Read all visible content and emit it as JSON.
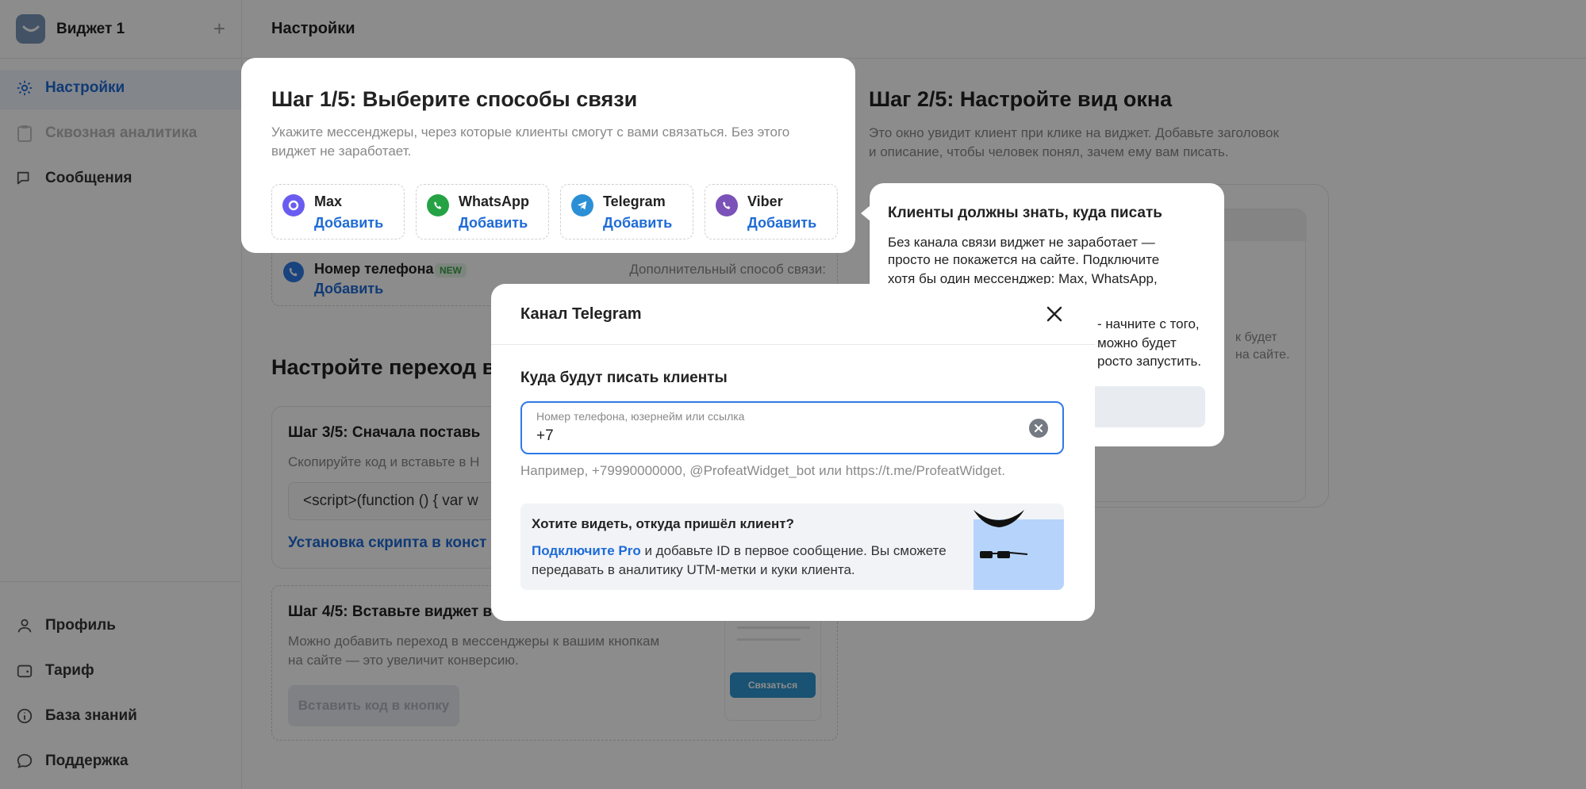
{
  "sidebar": {
    "widget_name": "Виджет 1",
    "items": [
      {
        "label": "Настройки"
      },
      {
        "label": "Сквозная аналитика"
      },
      {
        "label": "Сообщения"
      }
    ],
    "bottom_items": [
      {
        "label": "Профиль"
      },
      {
        "label": "Тариф"
      },
      {
        "label": "База знаний"
      },
      {
        "label": "Поддержка"
      }
    ]
  },
  "header": {
    "title": "Настройки"
  },
  "step1": {
    "title": "Шаг 1/5: Выберите способы связи",
    "desc_line1": "Укажите мессенджеры, через которые клиенты смогут с вами связаться. Без этого",
    "desc_line2": "виджет не заработает.",
    "add_label": "Добавить",
    "messengers": [
      {
        "name": "Max",
        "color": "#6a5cf0"
      },
      {
        "name": "WhatsApp",
        "color": "#25a244"
      },
      {
        "name": "Telegram",
        "color": "#2b8fd6"
      },
      {
        "name": "Viber",
        "color": "#7a52b8"
      }
    ],
    "phone": {
      "name": "Номер телефона",
      "badge": "NEW",
      "extra": "Дополнительный способ связи:",
      "add": "Добавить"
    }
  },
  "step2": {
    "title": "Шаг 2/5: Настройте вид окна",
    "desc_line1": "Это окно увидит клиент при клике на виджет. Добавьте заголовок",
    "desc_line2": "и описание, чтобы человек понял, зачем ему вам писать.",
    "bg_line1": "к будет",
    "bg_line2": "на сайте."
  },
  "tooltip": {
    "title": "Клиенты должны знать, куда писать",
    "p1_l1": "Без канала связи виджет не заработает —",
    "p1_l2": "просто не покажется на сайте. Подключите",
    "p1_l3": "хотя бы один мессенджер: Max, WhatsApp,",
    "p2_l1": "- начните с того,",
    "p2_l2": "можно будет",
    "p2_l3": "росто запустить."
  },
  "transition": {
    "title": "Настройте переход в"
  },
  "step3": {
    "title": "Шаг 3/5: Сначала поставь",
    "desc": "Скопируйте код и вставьте в H",
    "code": "<script>(function () { var w",
    "link": "Установка скрипта в конст"
  },
  "step4": {
    "title": "Шаг 4/5: Вставьте виджет в",
    "desc_line1": "Можно добавить переход в мессенджеры к вашим кнопкам",
    "desc_line2": "на сайте — это увеличит конверсию.",
    "button": "Вставить код в кнопку",
    "preview_button": "Связаться"
  },
  "modal": {
    "title": "Канал Telegram",
    "section": "Куда будут писать клиенты",
    "input_placeholder": "Номер телефона, юзернейм или ссылка",
    "input_value": "+7",
    "hint": "Например, +79990000000, @ProfeatWidget_bot или https://t.me/ProfeatWidget.",
    "pro_title": "Хотите видеть, откуда пришёл клиент?",
    "pro_link": "Подключите Pro",
    "pro_text_rest": " и добавьте ID в первое сообщение. Вы сможете передавать в аналитику UTM-метки и куки клиента."
  }
}
